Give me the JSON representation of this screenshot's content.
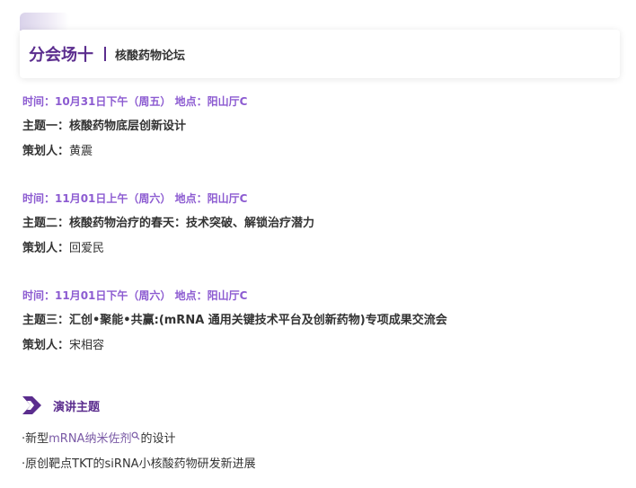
{
  "header": {
    "title": "分会场十",
    "subtitle": "核酸药物论坛"
  },
  "sessions": [
    {
      "meta": "时间：10月31日下午（周五）  地点：阳山厅C",
      "topic": "主题一：核酸药物底层创新设计",
      "curator_label": "策划人：",
      "curator_name": "黄震"
    },
    {
      "meta": "时间：11月01日上午（周六）  地点：阳山厅C",
      "topic": "主题二：核酸药物治疗的春天：技术突破、解锁治疗潜力",
      "curator_label": "策划人：",
      "curator_name": "回爱民"
    },
    {
      "meta": "时间：11月01日下午（周六）  地点：阳山厅C",
      "topic": "主题三：汇创•聚能•共赢:(mRNA 通用关键技术平台及创新药物)专项成果交流会",
      "curator_label": "策划人：",
      "curator_name": "宋相容"
    }
  ],
  "section": {
    "title": "演讲主题",
    "icon": "double-chevron-icon"
  },
  "talks": [
    {
      "prefix": "·新型",
      "highlight": "mRNA纳米佐剂",
      "suffix": "的设计"
    },
    {
      "text": "·原创靶点TKT的siRNA小核酸药物研发新进展"
    }
  ],
  "colors": {
    "brand": "#5b2d8e",
    "meta": "#8c5bd1",
    "text": "#333333"
  }
}
